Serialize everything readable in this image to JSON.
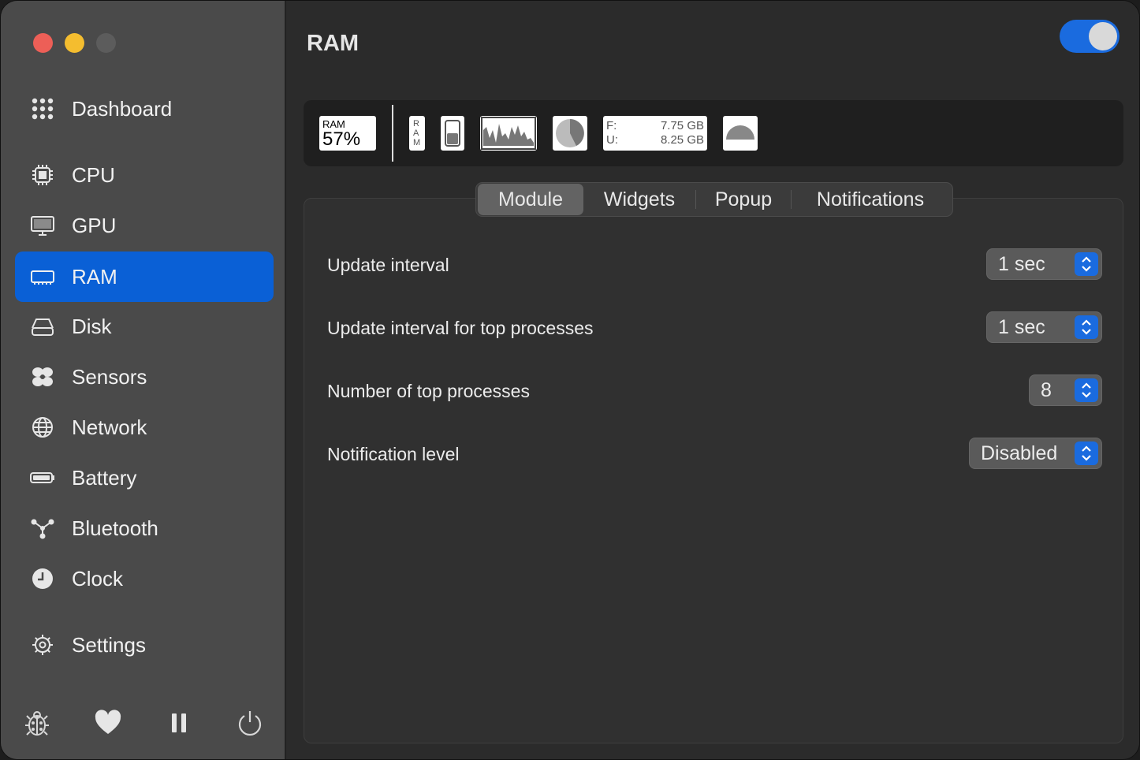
{
  "sidebar": {
    "items": [
      {
        "label": "Dashboard",
        "icon": "dashboard-grid-icon"
      },
      {
        "label": "CPU",
        "icon": "cpu-chip-icon"
      },
      {
        "label": "GPU",
        "icon": "monitor-icon"
      },
      {
        "label": "RAM",
        "icon": "memory-icon"
      },
      {
        "label": "Disk",
        "icon": "disk-drive-icon"
      },
      {
        "label": "Sensors",
        "icon": "fan-icon"
      },
      {
        "label": "Network",
        "icon": "globe-icon"
      },
      {
        "label": "Battery",
        "icon": "battery-icon"
      },
      {
        "label": "Bluetooth",
        "icon": "bluetooth-nodes-icon"
      },
      {
        "label": "Clock",
        "icon": "clock-icon"
      },
      {
        "label": "Settings",
        "icon": "gear-icon"
      }
    ],
    "active_label": "RAM",
    "footer_icons": [
      "bug-icon",
      "heart-icon",
      "pause-icon",
      "power-icon"
    ]
  },
  "header": {
    "title": "RAM",
    "module_enabled": true
  },
  "widgets": {
    "text_label": "RAM",
    "text_value": "57%",
    "mini_label": "R A M",
    "memory_free_label": "F:",
    "memory_free_value": "7.75 GB",
    "memory_used_label": "U:",
    "memory_used_value": "8.25 GB"
  },
  "tabs": [
    {
      "label": "Module",
      "active": true
    },
    {
      "label": "Widgets",
      "active": false
    },
    {
      "label": "Popup",
      "active": false
    },
    {
      "label": "Notifications",
      "active": false
    }
  ],
  "settings": {
    "update_interval": {
      "label": "Update interval",
      "value": "1 sec"
    },
    "update_interval_top": {
      "label": "Update interval for top processes",
      "value": "1 sec"
    },
    "top_processes": {
      "label": "Number of top processes",
      "value": "8"
    },
    "notification_level": {
      "label": "Notification level",
      "value": "Disabled"
    }
  },
  "colors": {
    "accent": "#0a60d6",
    "sidebar_bg": "#4a4a4a",
    "main_bg": "#2b2b2b"
  }
}
